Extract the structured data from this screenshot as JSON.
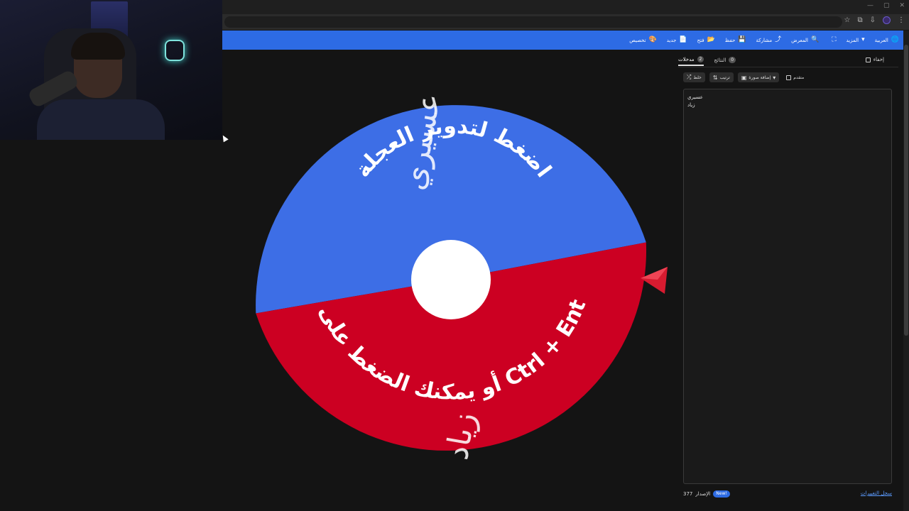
{
  "window": {
    "min": "—",
    "max": "▢",
    "close": "✕"
  },
  "browser": {
    "icons": [
      "star-icon",
      "extensions-icon",
      "menu-icon"
    ]
  },
  "nav": {
    "items": [
      {
        "key": "language",
        "label": "العربية",
        "icon": "🌐"
      },
      {
        "key": "more",
        "label": "المزيد",
        "icon": "▾"
      },
      {
        "key": "fullscreen",
        "label": "",
        "icon": "⛶"
      },
      {
        "key": "gallery",
        "label": "المعرض",
        "icon": "🔍"
      },
      {
        "key": "share",
        "label": "مشاركة",
        "icon": "⤴"
      },
      {
        "key": "save",
        "label": "حفظ",
        "icon": "💾"
      },
      {
        "key": "open",
        "label": "فتح",
        "icon": "📂"
      },
      {
        "key": "new",
        "label": "جديد",
        "icon": "📄"
      },
      {
        "key": "customize",
        "label": "تخصيص",
        "icon": "🎨"
      }
    ]
  },
  "wheel": {
    "colors": {
      "blue": "#3d6ee6",
      "red": "#cc0022",
      "center": "#ffffff"
    },
    "blue_names": [
      "عسيري"
    ],
    "red_names": [
      "زياد"
    ],
    "instruction_top": "اضغط لتدوير العجلة",
    "instruction_bottom": "أو يمكنك الضغط على زر Ctrl + Enter"
  },
  "panel": {
    "tabs": [
      {
        "label": "مدخلات",
        "count": "2",
        "active": true
      },
      {
        "label": "النتائج",
        "count": "0",
        "active": false
      }
    ],
    "hide_label": "إخفاء",
    "controls": {
      "shuffle": "خلط",
      "sort": "ترتيب",
      "add_image": "إضافة صورة",
      "advanced": "متقدم"
    },
    "entries": [
      "عسيري",
      "زياد"
    ],
    "version_label": "الإصدار",
    "version_number": "377",
    "new_badge": "New!",
    "changelog": "سجل التغييرات"
  }
}
